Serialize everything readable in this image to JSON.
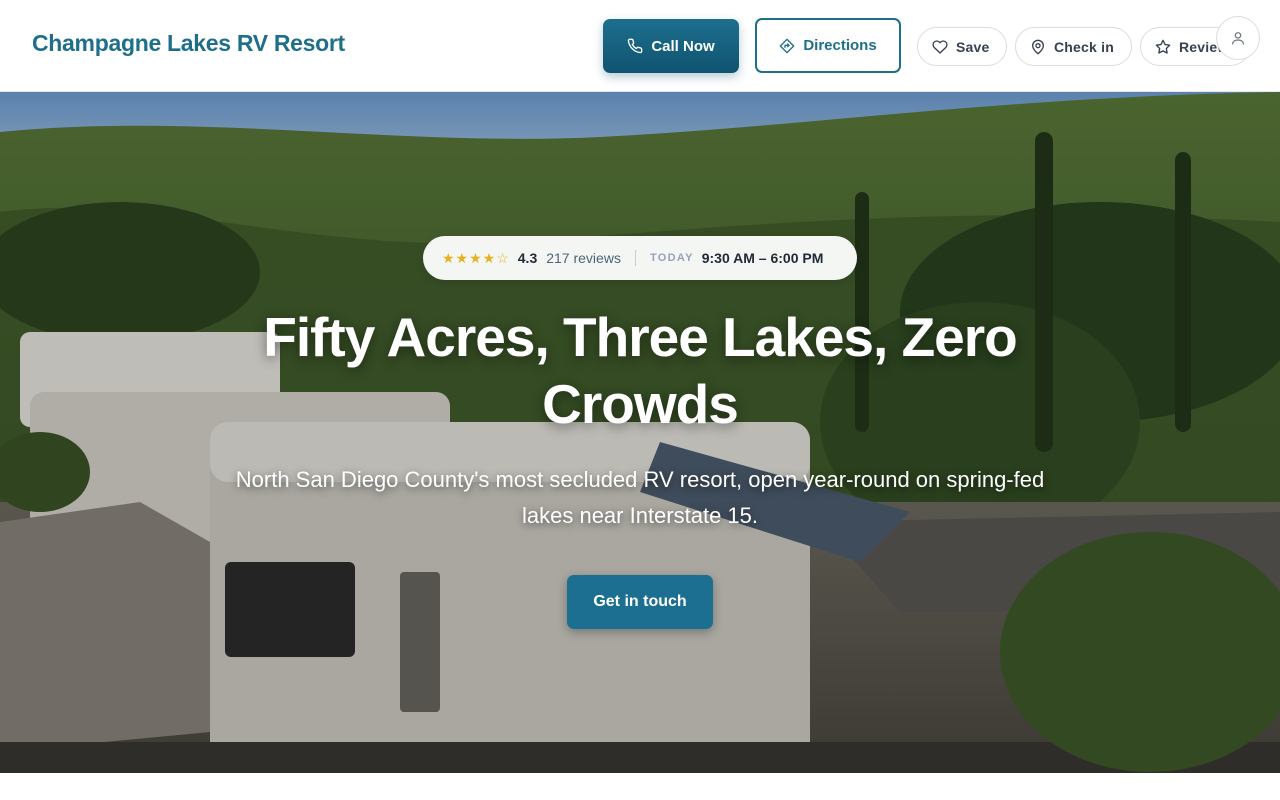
{
  "brand": {
    "name": "Champagne Lakes RV Resort"
  },
  "header": {
    "call_label": "Call Now",
    "directions_label": "Directions",
    "save_label": "Save",
    "checkin_label": "Check in",
    "review_label": "Review",
    "accent_color": "#1f6f8b"
  },
  "hero": {
    "rating_stars": "★★★★☆",
    "rating_value": "4.3",
    "reviews_text": "217 reviews",
    "today_label": "TODAY",
    "hours": "9:30 AM – 6:00 PM",
    "headline": "Fifty Acres, Three Lakes, Zero Crowds",
    "subheadline": "North San Diego County's most secluded RV resort, open year-round on spring-fed lakes near Interstate 15.",
    "cta_label": "Get in touch",
    "background_icon": "rv-resort-hillside-photo"
  }
}
